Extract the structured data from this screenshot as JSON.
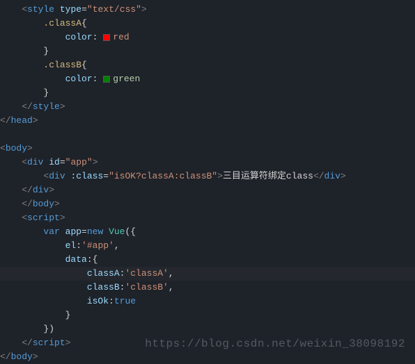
{
  "code": {
    "styleOpen": {
      "tag": "style",
      "attrName": "type",
      "attrVal": "\"text/css\""
    },
    "classA": {
      "selector": ".classA",
      "prop": "color",
      "val": "red"
    },
    "classB": {
      "selector": ".classB",
      "prop": "color",
      "val": "green"
    },
    "headClose": "head",
    "bodyOpen": "body",
    "divApp": {
      "tag": "div",
      "attrName": "id",
      "attrVal": "\"app\""
    },
    "divInner": {
      "tag": "div",
      "bindAttr": ":class",
      "bindVal": "\"isOK?classA:classB\"",
      "text": "三目运算符绑定class"
    },
    "bodyClose": "body",
    "scriptOpen": "script",
    "varDecl": {
      "kw": "var",
      "name": "app",
      "newKw": "new",
      "cls": "Vue"
    },
    "el": {
      "key": "el",
      "val": "'#app'"
    },
    "dataKey": "data",
    "classAProp": {
      "key": "classA",
      "val": "'classA'"
    },
    "classBProp": {
      "key": "classB",
      "val": "'classB'"
    },
    "isOk": {
      "key": "isOk",
      "val": "true"
    },
    "scriptClose": "script",
    "bodyTagClose": "body"
  },
  "watermark": "https://blog.csdn.net/weixin_38098192"
}
